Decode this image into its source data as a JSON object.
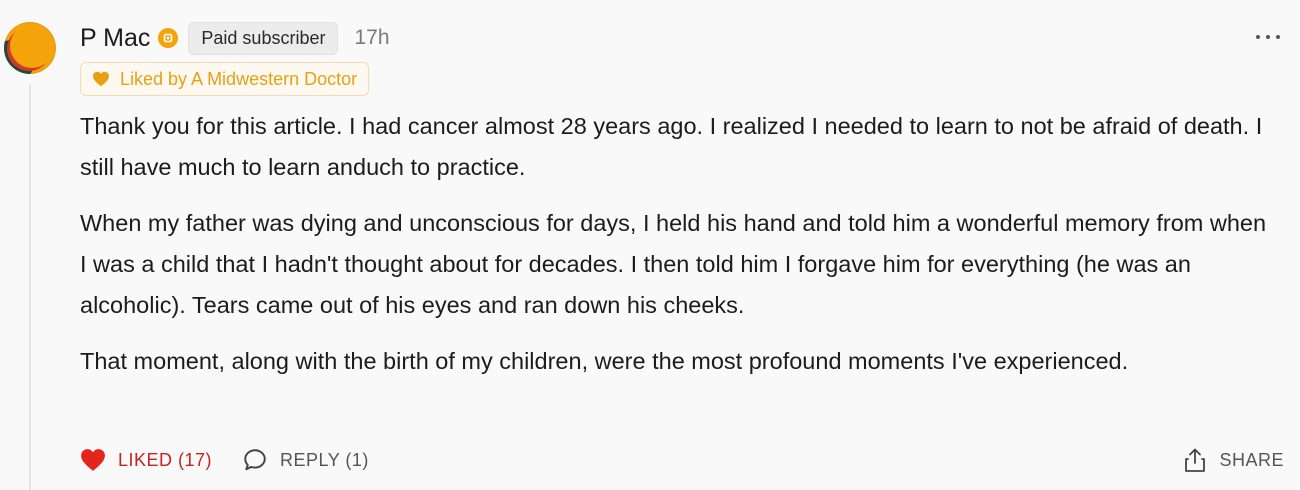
{
  "comment": {
    "author": "P Mac",
    "badge": "Paid subscriber",
    "timestamp": "17h",
    "liked_by": "Liked by A Midwestern Doctor",
    "paragraphs": [
      "Thank you for this article. I had cancer almost 28 years ago. I realized I needed to learn to not be afraid of death. I still have much to learn anduch to practice.",
      "When my father was dying and unconscious for days, I held his hand and told him a wonderful memory from when I was a child that I hadn't thought about for decades. I then told him I forgave him for everything (he was an alcoholic). Tears came out of his eyes and ran down his cheeks.",
      "That moment, along with the birth of my children, were the most profound moments I've experienced."
    ]
  },
  "actions": {
    "like_label": "LIKED (17)",
    "reply_label": "REPLY (1)",
    "share_label": "SHARE"
  },
  "icons": {
    "avatar": "avatar-image",
    "badge": "subscriber-badge-icon",
    "liked_by": "heart-icon",
    "more": "more-options-icon",
    "like": "heart-filled-icon",
    "reply": "comment-bubble-icon",
    "share": "share-icon"
  },
  "colors": {
    "accent": "#e8a013",
    "liked": "#c8231c",
    "background": "#f9f9f9",
    "text": "#1c1c1c",
    "muted": "#7a7a7a"
  }
}
